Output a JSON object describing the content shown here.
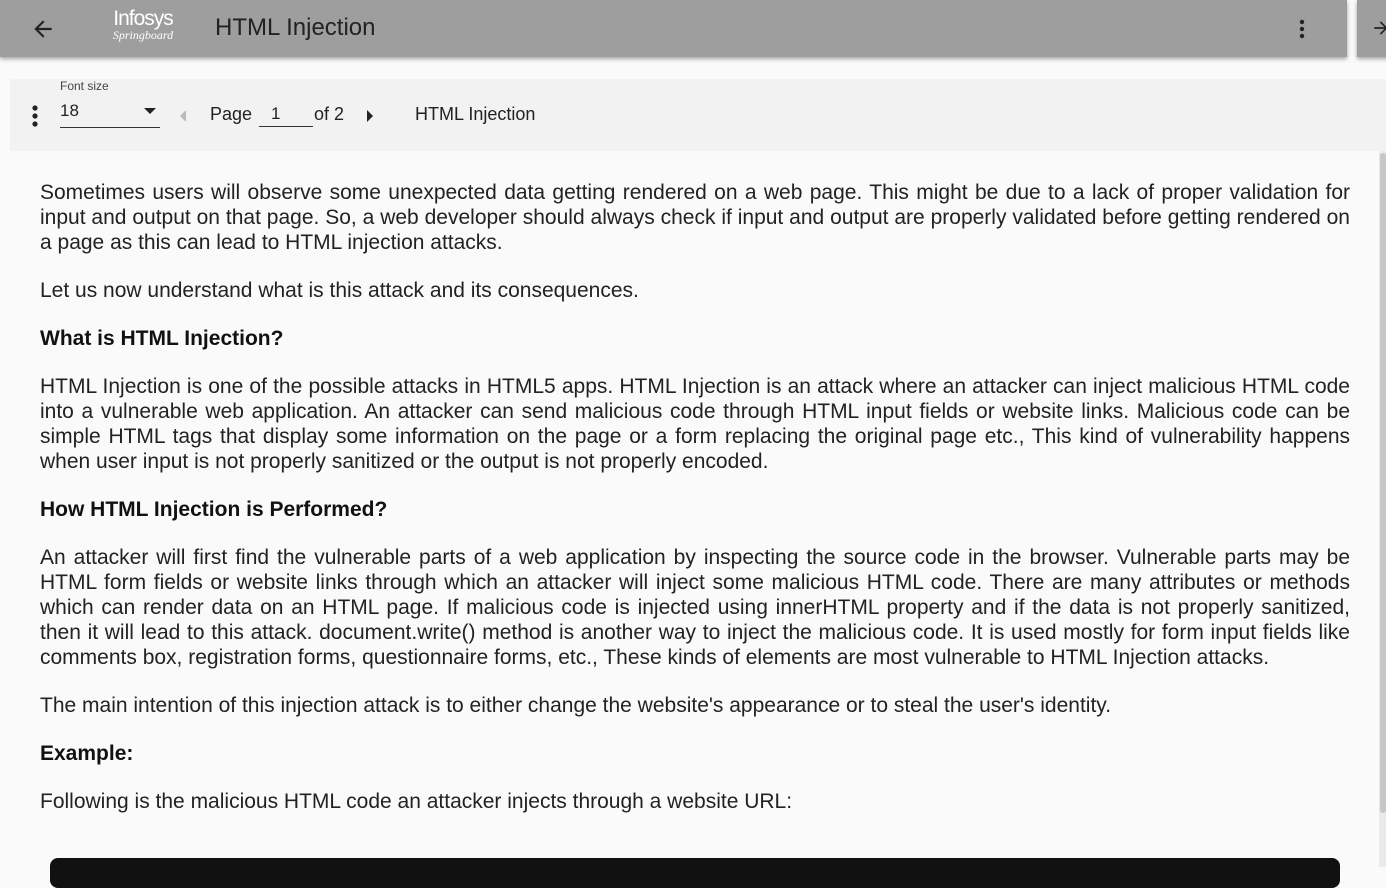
{
  "header": {
    "back_icon": "arrow-left-icon",
    "logo_line1": "Infosys",
    "logo_line2": "Springboard",
    "title": "HTML Injection",
    "menu_icon": "more-vertical-icon",
    "bar_color": "#9e9e9e"
  },
  "toolbar": {
    "menu_icon": "more-vertical-icon",
    "font_size_label": "Font size",
    "font_size_value": "18",
    "prev_icon": "caret-left-icon",
    "page_label": "Page",
    "page_value": "1",
    "of_label": "of 2",
    "next_icon": "caret-right-icon",
    "doc_title": "HTML Injection"
  },
  "content": {
    "p1": "Sometimes users will observe some unexpected data getting rendered on a web page. This might be due to a lack of proper validation for input and output on that page. So, a web developer should always check if input and output are properly validated before getting rendered on a page as this can lead to HTML injection attacks.",
    "p2": "Let us now understand what is this attack and its consequences.",
    "h1": "What is HTML Injection?",
    "p3": "HTML Injection is one of the possible attacks in HTML5 apps. HTML Injection is an attack where an attacker can inject malicious HTML code into a vulnerable web application.  An attacker can send malicious code through HTML input fields or website links. Malicious code can be simple HTML tags that display some information on the page or a form replacing the original page etc., This kind of vulnerability happens when user input is not properly sanitized or the output is not properly encoded.",
    "h2": "How HTML Injection is Performed?",
    "p4": "An attacker will first find the vulnerable parts of a web application by inspecting the source code in the browser. Vulnerable parts may be HTML form fields or website links through which an attacker will inject some malicious HTML code. There are many attributes or methods which can render data on an HTML page. If malicious code is injected using innerHTML property and if the data is not properly sanitized, then it will lead to this attack. document.write() method is another way to inject the malicious code. It is used mostly for form input fields like comments box, registration forms, questionnaire forms, etc., These kinds of elements are most vulnerable to HTML Injection attacks.",
    "p5": "The main intention of this injection attack is to either change the website's appearance or to steal the user's identity.",
    "h3": "Example:",
    "p6": "Following is the malicious HTML code an attacker injects through a website URL:"
  }
}
